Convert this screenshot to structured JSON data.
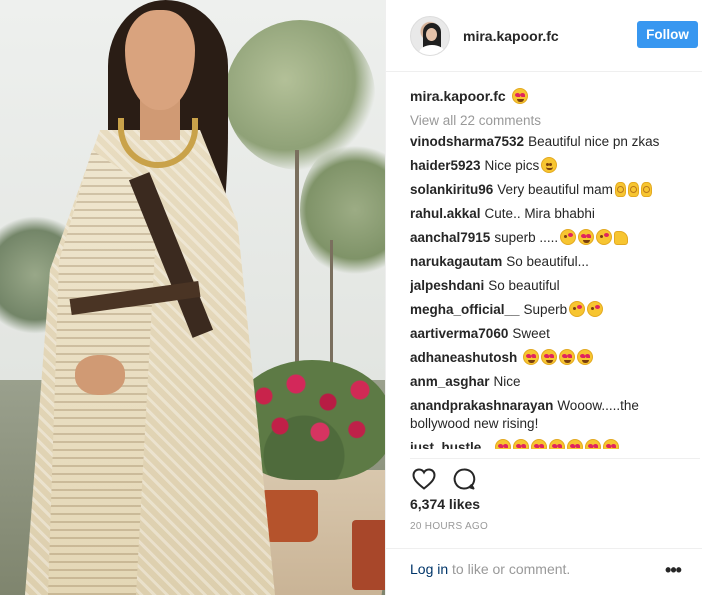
{
  "post": {
    "username": "mira.kapoor.fc",
    "follow_label": "Follow",
    "caption": {
      "username": "mira.kapoor.fc",
      "emoji": "heart-eyes-emoji"
    },
    "view_all": "View all 22 comments",
    "comments": [
      {
        "user": "vinodsharma7532",
        "text": "Beautiful nice pn zkas",
        "emojis": []
      },
      {
        "user": "haider5923",
        "text": "Nice pics",
        "emojis": [
          "smile"
        ]
      },
      {
        "user": "solankiritu96",
        "text": "Very beautiful mam",
        "emojis": [
          "ok",
          "ok",
          "ok"
        ]
      },
      {
        "user": "rahul.akkal",
        "text": "Cute.. Mira bhabhi",
        "emojis": []
      },
      {
        "user": "aanchal7915",
        "text": "superb .....",
        "emojis": [
          "kiss",
          "heart",
          "kiss",
          "thumb"
        ]
      },
      {
        "user": "narukagautam",
        "text": "So beautiful...",
        "emojis": []
      },
      {
        "user": "jalpeshdani",
        "text": "So beautiful",
        "emojis": []
      },
      {
        "user": "megha_official__",
        "text": "Superb",
        "emojis": [
          "kiss",
          "kiss"
        ]
      },
      {
        "user": "aartiverma7060",
        "text": "Sweet",
        "emojis": []
      },
      {
        "user": "adhaneashutosh",
        "text": "",
        "emojis": [
          "heart",
          "heart",
          "heart",
          "heart"
        ]
      },
      {
        "user": "anm_asghar",
        "text": "Nice",
        "emojis": []
      },
      {
        "user": "anandprakashnarayan",
        "text": "Wooow.....the bollywood new rising!",
        "emojis": []
      },
      {
        "user": "just_hustle_",
        "text": "",
        "emojis": [
          "heart",
          "heart",
          "heart",
          "heart",
          "heart",
          "heart",
          "heart"
        ]
      }
    ],
    "likes": "6,374 likes",
    "timestamp": "20 HOURS AGO",
    "footer": {
      "login": "Log in",
      "rest": " to like or comment."
    },
    "icons": {
      "like": "heart-outline-icon",
      "comment": "comment-bubble-icon",
      "more": "more-options-icon"
    }
  },
  "colors": {
    "follow_bg": "#3897f0",
    "link": "#003569",
    "muted": "#999999"
  }
}
